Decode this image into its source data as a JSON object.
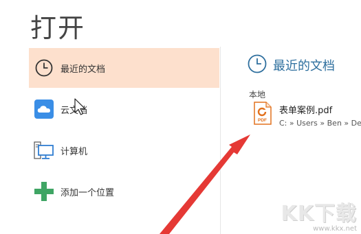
{
  "page": {
    "title": "打开"
  },
  "nav": {
    "items": [
      {
        "label": "最近的文档",
        "icon": "clock-icon",
        "active": true
      },
      {
        "label": "云文档",
        "icon": "cloud-icon",
        "active": false
      },
      {
        "label": "计算机",
        "icon": "computer-icon",
        "active": false
      },
      {
        "label": "添加一个位置",
        "icon": "plus-icon",
        "active": false
      }
    ]
  },
  "recent": {
    "title": "最近的文档",
    "section_label": "本地",
    "files": [
      {
        "name": "表单案例.pdf",
        "path": "C: » Users » Ben » Desktop",
        "icon": "pdf-file-icon",
        "icon_text": "PDF"
      }
    ]
  },
  "watermark": {
    "logo": "KK下载",
    "url": "www.kkx.net"
  },
  "colors": {
    "active_bg": "#fde0cd",
    "accent_blue": "#2e6f9e",
    "plus_green": "#3fa564",
    "cloud_blue": "#3a8ee6",
    "arrow_red": "#e53935"
  }
}
